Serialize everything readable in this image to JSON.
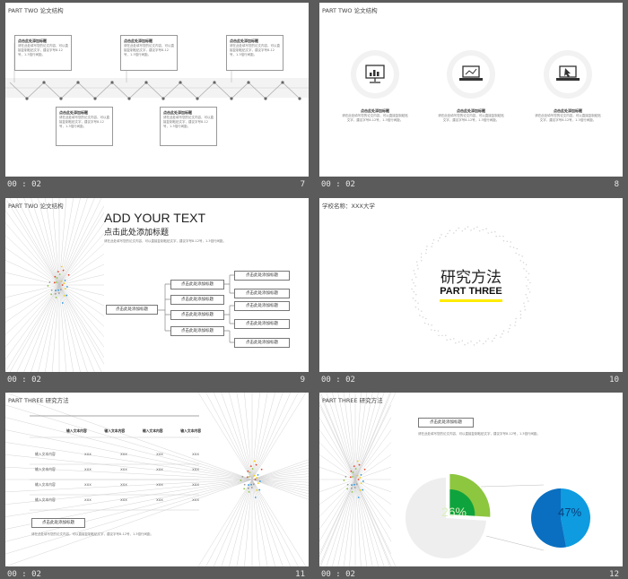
{
  "slides": [
    {
      "number": "7",
      "duration": "00 : 02",
      "title": "PART TWO 论文结构",
      "boxes": [
        {
          "heading": "点击此处添加标题",
          "text": "请在此处填写您的论文内容，可以直接复制粘贴文字，建议字号8-12号，1.3倍行间距。"
        },
        {
          "heading": "点击此处添加标题",
          "text": "请在此处填写您的论文内容，可以直接复制粘贴文字，建议字号8-12号，1.3倍行间距。"
        },
        {
          "heading": "点击此处添加标题",
          "text": "请在此处填写您的论文内容，可以直接复制粘贴文字，建议字号8-12号，1.3倍行间距。"
        },
        {
          "heading": "点击此处添加标题",
          "text": "请在此处填写您的论文内容，可以直接复制粘贴文字，建议字号8-12号，1.3倍行间距。"
        },
        {
          "heading": "点击此处添加标题",
          "text": "请在此处填写您的论文内容，可以直接复制粘贴文字，建议字号8-12号，1.3倍行间距。"
        }
      ]
    },
    {
      "number": "8",
      "duration": "00 : 02",
      "title": "PART TWO 论文结构",
      "items": [
        {
          "icon": "chart-monitor-icon",
          "heading": "点击此处添加标题",
          "text": "请在此处填写您的论文内容，可以直接复制粘贴文字，建议字号8-12号，1.3倍行间距。"
        },
        {
          "icon": "laptop-chart-icon",
          "heading": "点击此处添加标题",
          "text": "请在此处填写您的论文内容，可以直接复制粘贴文字，建议字号8-12号，1.3倍行间距。"
        },
        {
          "icon": "laptop-pointer-icon",
          "heading": "点击此处添加标题",
          "text": "请在此处填写您的论文内容，可以直接复制粘贴文字，建议字号8-12号，1.3倍行间距。"
        }
      ]
    },
    {
      "number": "9",
      "duration": "00 : 02",
      "title": "PART TWO 论文结构",
      "headline": "ADD YOUR TEXT",
      "subhead": "点击此处添加标题",
      "body": "请在此处填写您的论文内容，可以直接复制粘贴文字，建议字号8-12号，1.3倍行间距。",
      "root": "点击此处添加标题",
      "level2": [
        "点击此处添加标题",
        "点击此处添加标题",
        "点击此处添加标题",
        "点击此处添加标题"
      ],
      "level3": [
        "点击此处添加标题",
        "点击此处添加标题",
        "点击此处添加标题",
        "点击此处添加标题",
        "点击此处添加标题",
        "点击此处添加标题"
      ]
    },
    {
      "number": "10",
      "duration": "00 : 02",
      "title": "学校名称：XXX大学",
      "main_title": "研究方法",
      "part_label": "PART THREE",
      "accent": "#ffeb00"
    },
    {
      "number": "11",
      "duration": "00 : 02",
      "title": "PART THREE 研究方法",
      "table": {
        "headers": [
          "输入文本内容",
          "输入文本内容",
          "输入文本内容",
          "输入文本内容"
        ],
        "rows": [
          [
            "输入文本内容",
            "XXX",
            "XXX",
            "XXX",
            "XXX"
          ],
          [
            "输入文本内容",
            "XXX",
            "XXX",
            "XXX",
            "XXX"
          ],
          [
            "输入文本内容",
            "XXX",
            "XXX",
            "XXX",
            "XXX"
          ],
          [
            "输入文本内容",
            "XXX",
            "XXX",
            "XXX",
            "XXX"
          ]
        ]
      },
      "caption_title": "点击此处添加标题",
      "caption_text": "请在此处填写您的论文内容，可以直接复制粘贴文字，建议字号8-12号，1.3倍行间距。"
    },
    {
      "number": "12",
      "duration": "00 : 02",
      "title": "PART THREE 研究方法",
      "caption_title": "点击此处添加标题",
      "caption_text": "请在此处填写您的论文内容，可以直接复制粘贴文字，建议字号8-12号，1.3倍行间距。",
      "chart_data": [
        {
          "type": "pie",
          "values": [
            26,
            74
          ],
          "labels": [
            "26%",
            ""
          ],
          "colors": [
            "#8dc63f",
            "#eeeeee"
          ],
          "title": "",
          "xlabel": "",
          "ylabel": ""
        },
        {
          "type": "pie",
          "values": [
            47,
            53
          ],
          "labels": [
            "47%",
            ""
          ],
          "colors": [
            "#0e9be0",
            "#0a6fc0"
          ],
          "title": "",
          "xlabel": "",
          "ylabel": ""
        }
      ]
    }
  ]
}
